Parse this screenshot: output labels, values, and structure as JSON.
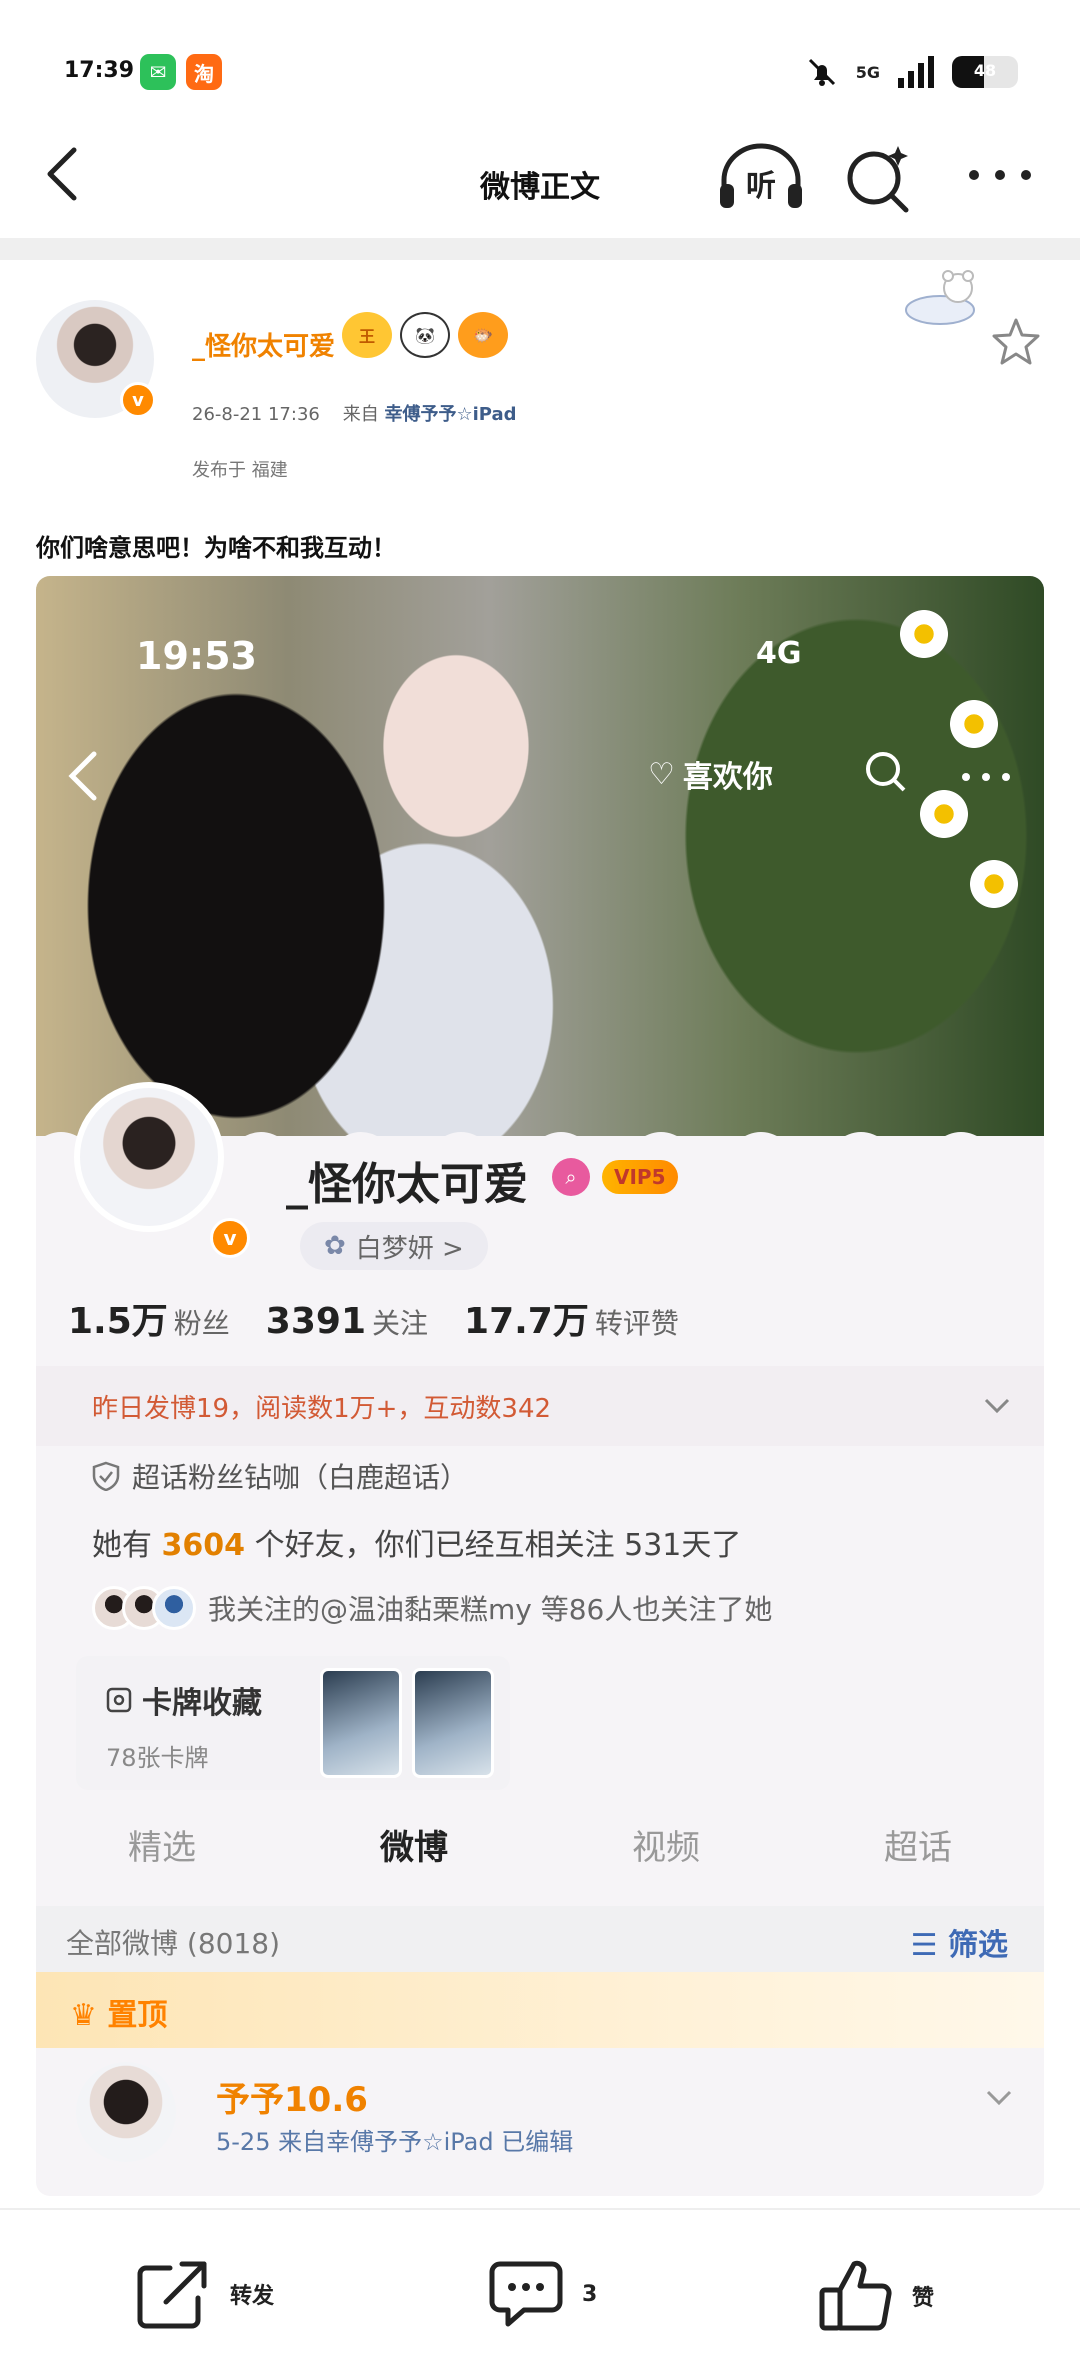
{
  "status_bar": {
    "time": "17:39",
    "apps": [
      {
        "name": "wechat-icon",
        "glyph": "✉",
        "color": "#2dc15a"
      },
      {
        "name": "taobao-icon",
        "glyph": "淘",
        "color": "#ff6a13"
      }
    ],
    "network": "5G",
    "battery": 48,
    "battery_label": "48"
  },
  "nav": {
    "title": "微博正文",
    "listen_label": "听"
  },
  "post": {
    "username": "_怪你太可爱",
    "verified_badge": "v",
    "time": "26-8-21 17:36",
    "from_prefix": "来自",
    "source": "幸傅予予☆iPad",
    "location": "发布于 福建",
    "text": "你们啥意思吧！为啥不和我互动！",
    "badges": [
      "王",
      "🐼",
      "🐡"
    ]
  },
  "image": {
    "phone_time": "19:53",
    "phone_signal": "4G",
    "like_label": "喜欢你",
    "profile": {
      "name": "_怪你太可爱",
      "vip": "VIP5",
      "fanclub": "白梦妍 >",
      "stats": [
        {
          "num": "1.5万",
          "label": "粉丝"
        },
        {
          "num": "3391",
          "label": "关注"
        },
        {
          "num": "17.7万",
          "label": "转评赞"
        }
      ],
      "yesterday": "昨日发博19，阅读数1万+，互动数342",
      "super_topic": "超话粉丝钻咖（白鹿超话）",
      "friends_prefix": "她有",
      "friends_count": "3604",
      "friends_suffix": "个好友，你们已经互相关注 531天了",
      "mutual": "我关注的@温油黏栗糕my 等86人也关注了她",
      "cards_title": "卡牌收藏",
      "cards_count": "78张卡牌",
      "tabs": [
        "精选",
        "微博",
        "视频",
        "超话"
      ],
      "all_posts": "全部微博 (8018)",
      "filter": "筛选",
      "pinned": "置顶",
      "post_name": "予予10.6",
      "post_meta": "5-25 来自幸傅予予☆iPad 已编辑"
    }
  },
  "bottom_bar": {
    "repost_label": "转发",
    "comment_count": "3",
    "like_label": "赞"
  },
  "colors": {
    "accent_orange": "#f08200",
    "link_blue": "#3e5d8a"
  }
}
